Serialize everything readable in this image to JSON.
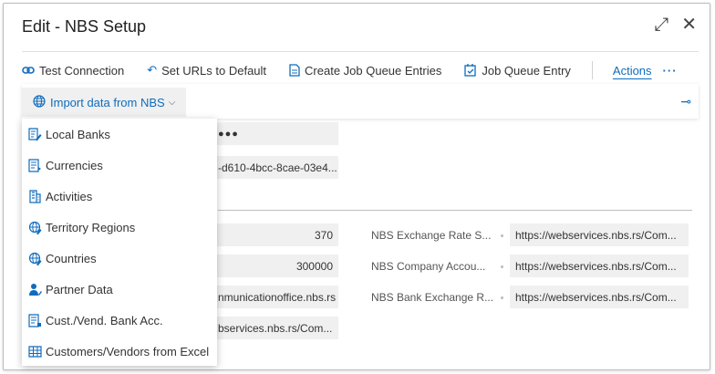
{
  "window": {
    "title": "Edit - NBS Setup",
    "expand_icon": "expand-icon",
    "close_icon": "close-icon"
  },
  "toolbar": {
    "test_connection": "Test Connection",
    "set_urls": "Set URLs to Default",
    "create_jq": "Create Job Queue Entries",
    "jq_entry": "Job Queue Entry",
    "actions": "Actions",
    "more": "···"
  },
  "promoted": {
    "import_label": "Import data from NBS",
    "chevron": "⌵"
  },
  "dropdown": {
    "items": [
      {
        "label": "Local Banks",
        "icon": "bank-edit-icon"
      },
      {
        "label": "Currencies",
        "icon": "currency-icon"
      },
      {
        "label": "Activities",
        "icon": "building-icon"
      },
      {
        "label": "Territory Regions",
        "icon": "globe-edit-icon"
      },
      {
        "label": "Countries",
        "icon": "globe-edit-icon"
      },
      {
        "label": "Partner Data",
        "icon": "person-icon"
      },
      {
        "label": "Cust./Vend. Bank Acc.",
        "icon": "document-icon"
      },
      {
        "label": "Customers/Vendors from Excel",
        "icon": "table-icon"
      }
    ]
  },
  "fields": {
    "password": "●●●",
    "guid": "-d610-4bcc-8cae-03e4...",
    "num1": "370",
    "num2": "300000",
    "url_comm": "nmunicationoffice.nbs.rs",
    "url_ws": "bservices.nbs.rs/Com...",
    "exchange_rate_label": "NBS Exchange Rate S...",
    "exchange_rate_value": "https://webservices.nbs.rs/Com...",
    "company_label": "NBS Company Accou...",
    "company_value": "https://webservices.nbs.rs/Com...",
    "bank_exchange_label": "NBS Bank Exchange R...",
    "bank_exchange_value": "https://webservices.nbs.rs/Com..."
  },
  "colors": {
    "accent": "#0f6cbd",
    "field_bg": "#f0f0f0"
  }
}
